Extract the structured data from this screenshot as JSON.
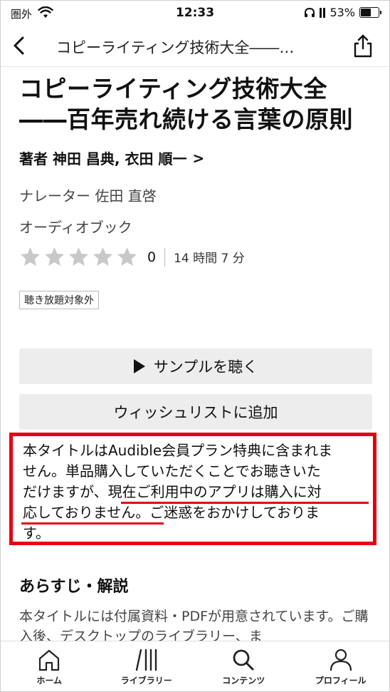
{
  "status": {
    "carrier": "圏外",
    "time": "12:33",
    "battery": "53%"
  },
  "nav": {
    "title": "コピーライティング技術大全――…"
  },
  "book": {
    "title_line1": "コピーライティング技術大全",
    "title_line2": "――百年売れ続ける言葉の原則",
    "author": "著者 神田 昌典, 衣田 順一",
    "author_chevron": ">",
    "narrator": "ナレーター 佐田 直啓",
    "format": "オーディオブック",
    "rating_count": "0",
    "rating_stars": 0,
    "length": "14 時間 7 分",
    "badge": "聴き放題対象外"
  },
  "actions": {
    "sample": "サンプルを聴く",
    "wishlist": "ウィッシュリストに追加"
  },
  "notice": {
    "line1": "本タイトルはAudible会員プラン特典に含まれま",
    "line2": "せん。単品購入していただくことでお聴きいた",
    "line3": "だけますが、現在ご利用中のアプリは購入に対",
    "line4": "応しておりません。ご迷惑をおかけしておりま",
    "line5": "す。"
  },
  "synopsis": {
    "title": "あらすじ・解説",
    "text": "本タイトルには付属資料・PDFが用意されています。ご購入後、デスクトップのライブラリー、ま"
  },
  "tabs": [
    {
      "label": "ホーム",
      "icon": "home-icon"
    },
    {
      "label": "ライブラリー",
      "icon": "library-icon"
    },
    {
      "label": "コンテンツ",
      "icon": "search-icon"
    },
    {
      "label": "プロフィール",
      "icon": "profile-icon"
    }
  ],
  "colors": {
    "highlight": "#e60012",
    "button_bg": "#ededed",
    "star": "#c8c8c8"
  }
}
